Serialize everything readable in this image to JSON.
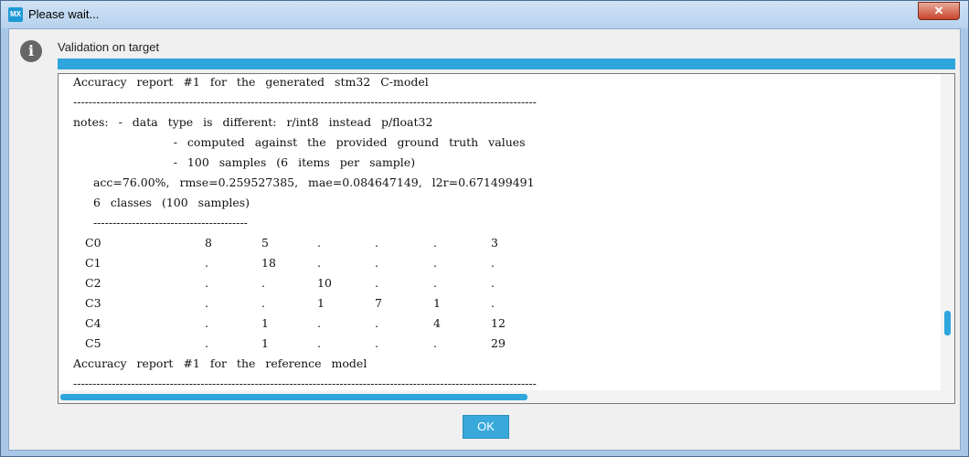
{
  "window": {
    "app_icon_text": "MX",
    "title": "Please wait...",
    "close_label": "✕"
  },
  "dialog": {
    "heading": "Validation on target",
    "ok_label": "OK"
  },
  "log": {
    "lines": [
      "Accuracy report #1 for the generated stm32 C-model",
      "------------------------------------------------------------------------------------------------------------------------",
      "notes: - data type is different: r/int8 instead p/float32",
      "          - computed against the provided ground truth values",
      "          - 100 samples (6 items per sample)",
      "  acc=76.00%, rmse=0.259527385, mae=0.084647149, l2r=0.671499491",
      "  6 classes (100 samples)",
      "  ----------------------------------------"
    ],
    "confusion": [
      {
        "label": "C0",
        "cells": [
          "8",
          "5",
          ".",
          ".",
          ".",
          "3"
        ]
      },
      {
        "label": "C1",
        "cells": [
          ".",
          "18",
          ".",
          ".",
          ".",
          "."
        ]
      },
      {
        "label": "C2",
        "cells": [
          ".",
          ".",
          "10",
          ".",
          ".",
          "."
        ]
      },
      {
        "label": "C3",
        "cells": [
          ".",
          ".",
          "1",
          "7",
          "1",
          "."
        ]
      },
      {
        "label": "C4",
        "cells": [
          ".",
          "1",
          ".",
          ".",
          "4",
          "12"
        ]
      },
      {
        "label": "C5",
        "cells": [
          ".",
          "1",
          ".",
          ".",
          ".",
          "29"
        ]
      }
    ],
    "tail_lines": [
      "Accuracy report #1 for the reference model",
      "------------------------------------------------------------------------------------------------------------------------"
    ]
  }
}
